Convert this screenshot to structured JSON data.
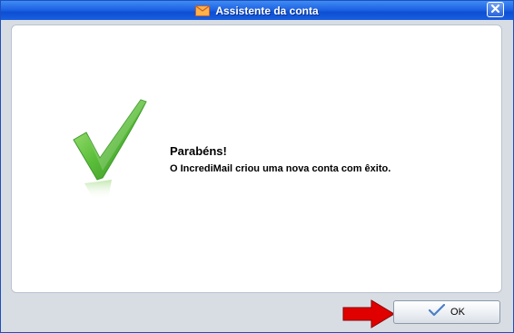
{
  "window": {
    "title": "Assistente da conta",
    "title_icon": "envelope-icon",
    "close_icon": "close-icon"
  },
  "message": {
    "heading": "Parabéns!",
    "body": "O IncrediMail criou uma nova conta com êxito.",
    "status_icon": "checkmark-icon"
  },
  "footer": {
    "ok_label": "OK",
    "ok_icon": "checkmark-small-icon",
    "annotation_icon": "red-arrow-icon"
  },
  "colors": {
    "titlebar": "#1f64e4",
    "check_green": "#4caf3a",
    "arrow_red": "#e00000"
  }
}
